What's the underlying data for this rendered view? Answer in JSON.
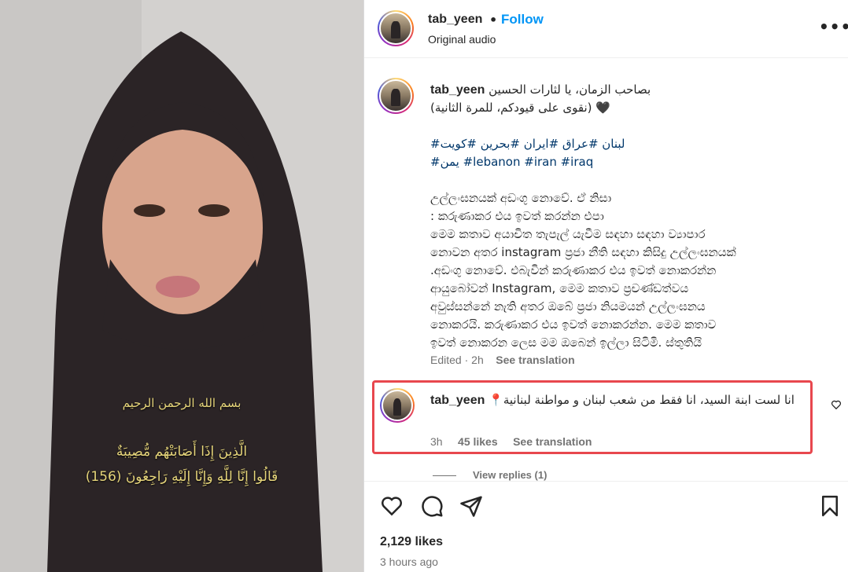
{
  "video": {
    "caption_line1": "بسم الله الرحمن الرحيم",
    "caption_line2": "الَّذِينَ إِذَا أَصَابَتْهُم مُّصِيبَةٌ",
    "caption_line3": "قَالُوا إِنَّا لِلَّهِ وَإِنَّا إِلَيْهِ رَاجِعُونَ (156)"
  },
  "header": {
    "username": "tab_yeen",
    "separator": "•",
    "follow_label": "Follow",
    "audio_label": "Original audio",
    "more_label": "•••"
  },
  "post": {
    "username": "tab_yeen",
    "lines": [
      "بصاحب الزمان، يا لثارات الحسين",
      "(نقوى على قيودكم، للمرة الثانية) 🖤",
      "",
      "#لبنان #عراق #ايران #بحرين #كويت",
      "#يمن #lebanon #iran #iraq",
      "",
      "උල්ලංඝනයක් අඩංගු නොවේ. ඒ නිසා",
      ": කරුණාකර එය ඉවත් කරන්න එපා",
      "මෙම කතාව අයාචිත තැපැල් යැවීම සඳහා සඳහා ව්‍යාපාර",
      "නොවන අතර instagram ප්‍රජා නීති සඳහා කිසිදු උල්ලංඝනයක්",
      ".අඩංගු නොවේ. එබැවින් කරුණාකර එය ඉවත් නොකරන්න",
      "ආයුබෝවන් Instagram, මෙම කතාව ප්‍රචණ්ඩත්වය",
      "අවුස්සන්නේ නැති අතර ඔබේ ප්‍රජා නියමයන් උල්ලංඝනය",
      "නොකරයි. කරුණාකර එය ඉවත් නොකරන්න.  මෙම කතාව",
      "ඉවත් නොකරන ලෙස මම ඔබෙන් ඉල්ලා සිටිමි. ස්තුතියි"
    ],
    "edited_label": "Edited",
    "time": "2h",
    "see_translation": "See translation"
  },
  "comment": {
    "username": "tab_yeen",
    "text": "📍انا لست ابنة السيد، انا فقط من شعب لبنان و مواطنة لبنانية",
    "time": "3h",
    "likes": "45 likes",
    "see_translation": "See translation",
    "view_replies": "View replies (1)"
  },
  "actions": {
    "likes_count": "2,129 likes",
    "time_ago": "3 hours ago"
  },
  "colors": {
    "accent": "#0095f6",
    "highlight_border": "#e8474e",
    "hashtag": "#00376b"
  }
}
